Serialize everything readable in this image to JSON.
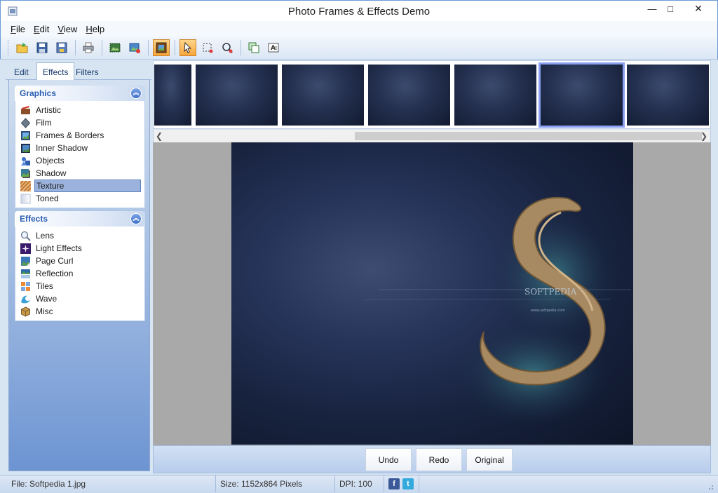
{
  "window": {
    "title": "Photo Frames & Effects Demo",
    "minimize": "—",
    "maximize": "□",
    "close": "✕"
  },
  "menu": [
    {
      "label": "File",
      "u": "F",
      "rest": "ile"
    },
    {
      "label": "Edit",
      "u": "E",
      "rest": "dit"
    },
    {
      "label": "View",
      "u": "V",
      "rest": "iew"
    },
    {
      "label": "Help",
      "u": "H",
      "rest": "elp"
    }
  ],
  "toolbar": {
    "buttons": [
      "open-icon",
      "save-icon",
      "save-as-icon",
      "print-icon",
      "crop-icon",
      "add-image-icon",
      "frame-icon",
      "pointer-icon",
      "selection-icon",
      "zoom-icon",
      "copy-icon",
      "text-icon"
    ],
    "active": [
      "frame-icon",
      "pointer-icon"
    ]
  },
  "tabs": {
    "edit": "Edit",
    "effects": "Effects",
    "filters": "Filters",
    "selected": "Effects"
  },
  "graphics": {
    "title": "Graphics",
    "items": [
      {
        "label": "Artistic",
        "icon": "artistic-icon"
      },
      {
        "label": "Film",
        "icon": "film-icon"
      },
      {
        "label": "Frames & Borders",
        "icon": "frames-icon"
      },
      {
        "label": "Inner Shadow",
        "icon": "inner-shadow-icon"
      },
      {
        "label": "Objects",
        "icon": "objects-icon"
      },
      {
        "label": "Shadow",
        "icon": "shadow-icon"
      },
      {
        "label": "Texture",
        "icon": "texture-icon"
      },
      {
        "label": "Toned",
        "icon": "toned-icon"
      }
    ],
    "selected": "Texture"
  },
  "effects": {
    "title": "Effects",
    "items": [
      {
        "label": "Lens",
        "icon": "lens-icon"
      },
      {
        "label": "Light Effects",
        "icon": "light-effects-icon"
      },
      {
        "label": "Page Curl",
        "icon": "page-curl-icon"
      },
      {
        "label": "Reflection",
        "icon": "reflection-icon"
      },
      {
        "label": "Tiles",
        "icon": "tiles-icon"
      },
      {
        "label": "Wave",
        "icon": "wave-icon"
      },
      {
        "label": "Misc",
        "icon": "misc-icon"
      }
    ]
  },
  "thumbnails": {
    "count": 7,
    "selected_index": 5
  },
  "actions": {
    "undo": "Undo",
    "redo": "Redo",
    "original": "Original"
  },
  "status": {
    "file": "File: Softpedia 1.jpg",
    "size": "Size: 1152x864 Pixels",
    "dpi": "DPI: 100",
    "facebook": "f",
    "twitter": "t"
  },
  "photo_text": {
    "brand": "SOFTPEDIA",
    "url": "www.softpedia.com"
  },
  "colors": {
    "accent": "#2a5db0",
    "selection": "#9bb3dc",
    "active_tool": "#f8a53a"
  }
}
